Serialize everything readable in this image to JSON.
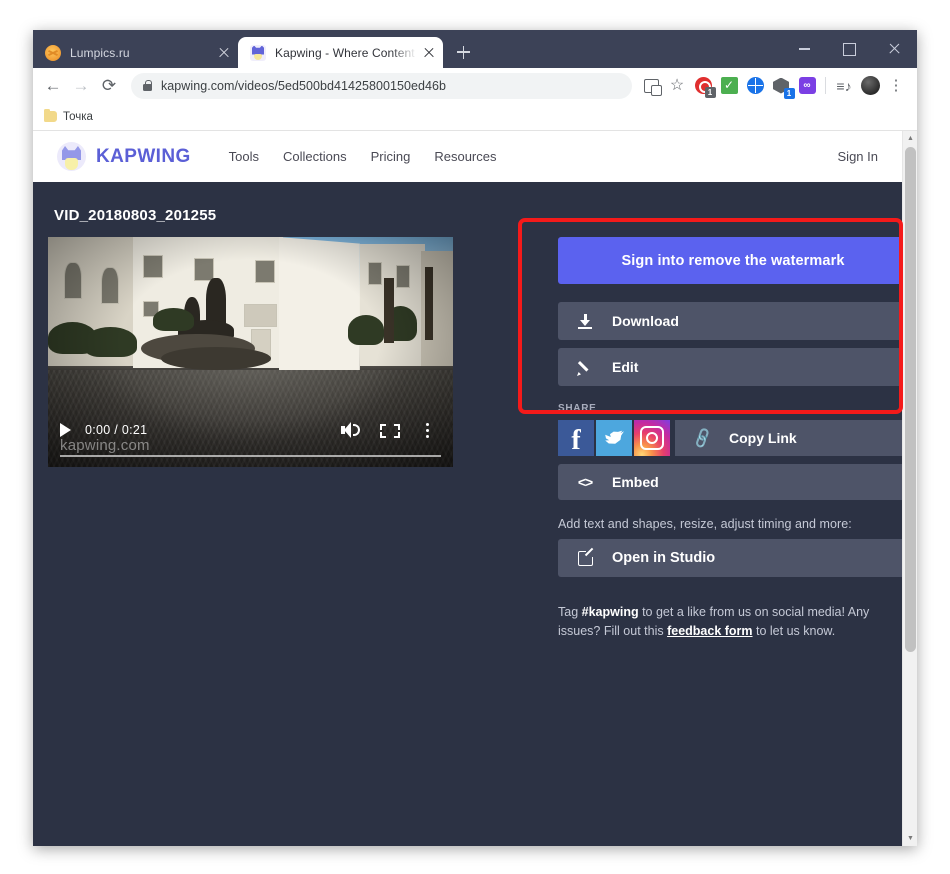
{
  "browser": {
    "tabs": [
      {
        "title": "Lumpics.ru",
        "favicon": "orange-circle-icon",
        "active": false
      },
      {
        "title": "Kapwing - Where Content Creati",
        "favicon": "kapwing-cat-icon",
        "active": true
      }
    ],
    "new_tab_label": "+",
    "window_controls": {
      "minimize": "—",
      "maximize": "□",
      "close": "✕"
    },
    "nav": {
      "back": "←",
      "forward": "→",
      "reload": "⟳"
    },
    "address": {
      "url": "kapwing.com/videos/5ed500bd41425800150ed46b",
      "lock": "lock-icon"
    },
    "toolbar_icons": [
      "translate-icon",
      "bookmark-star-icon",
      "adblock-icon",
      "checkmark-extension-icon",
      "globe-extension-icon",
      "box-extension-icon",
      "purple-extension-icon",
      "reading-list-icon",
      "profile-avatar-icon",
      "chrome-menu-icon"
    ],
    "bookmarks": [
      {
        "label": "Точка",
        "icon": "folder-icon"
      }
    ]
  },
  "site": {
    "logo_text": "KAPWING",
    "nav_items": [
      "Tools",
      "Collections",
      "Pricing",
      "Resources"
    ],
    "sign_in": "Sign In"
  },
  "main": {
    "video_title": "VID_20180803_201255",
    "player": {
      "current_time": "0:00",
      "duration": "0:21",
      "time_display": "0:00 / 0:21",
      "watermark": "kapwing.com",
      "play_icon": "play-icon",
      "volume_icon": "volume-icon",
      "fullscreen_icon": "fullscreen-icon",
      "more_icon": "kebab-menu-icon"
    }
  },
  "panel": {
    "signin_watermark": {
      "strong": "Sign in",
      "rest": " to remove the watermark"
    },
    "download_label": "Download",
    "edit_label": "Edit",
    "share_label": "SHARE",
    "social": [
      {
        "name": "facebook",
        "color": "#3b5998"
      },
      {
        "name": "twitter",
        "color": "#4da7de"
      },
      {
        "name": "instagram",
        "color": "#c32aa3"
      }
    ],
    "copy_link_label": "Copy Link",
    "embed_label": "Embed",
    "studio_hint": "Add text and shapes, resize, adjust timing and more:",
    "open_studio_label": "Open in Studio",
    "footnote": {
      "pre": "Tag ",
      "tag": "#kapwing",
      "mid": " to get a like from us on social media! Any issues? Fill out this ",
      "link": "feedback form",
      "post": " to let us know."
    }
  },
  "colors": {
    "page_bg": "#2c3244",
    "accent_primary": "#5b62ef",
    "button_grey": "#4e5468",
    "annotation_red": "#f41a1a",
    "brand_purple": "#5b5fd6"
  }
}
